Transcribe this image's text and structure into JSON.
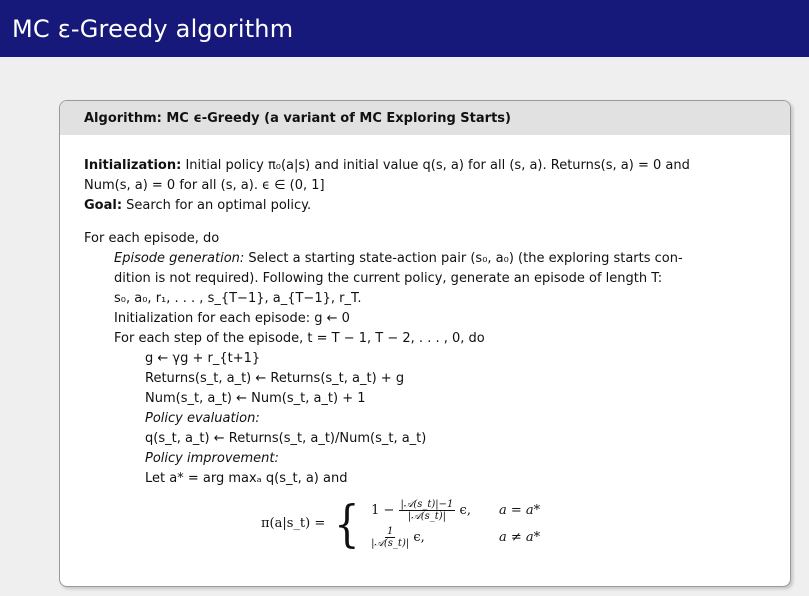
{
  "title": "MC ε-Greedy algorithm",
  "algorithm": {
    "header": "Algorithm: MC ϵ-Greedy (a variant of MC Exploring Starts)",
    "initialization_label": "Initialization:",
    "initialization_line1": "Initial policy π₀(a|s) and initial value q(s, a) for all (s, a). Returns(s, a) = 0 and",
    "initialization_line2": "Num(s, a) = 0 for all (s, a). ϵ ∈ (0, 1]",
    "goal_label": "Goal:",
    "goal_text": "Search for an optimal policy.",
    "for_each_episode": "For each episode, do",
    "episode_generation_label": "Episode generation:",
    "episode_generation_line1": "Select a starting state-action pair (s₀, a₀) (the exploring starts con-",
    "episode_generation_line2": "dition is not required). Following the current policy, generate an episode of length T:",
    "episode_generation_line3": "s₀, a₀, r₁, . . . , s_{T−1}, a_{T−1}, r_T.",
    "init_each_episode": "Initialization for each episode: g ← 0",
    "for_each_step": "For each step of the episode, t = T − 1, T − 2, . . . , 0, do",
    "step_g": "g ← γg + r_{t+1}",
    "step_returns": "Returns(s_t, a_t) ← Returns(s_t, a_t) + g",
    "step_num": "Num(s_t, a_t) ← Num(s_t, a_t) + 1",
    "policy_evaluation_label": "Policy evaluation:",
    "policy_evaluation_eq": "q(s_t, a_t) ← Returns(s_t, a_t)/Num(s_t, a_t)",
    "policy_improvement_label": "Policy improvement:",
    "let_line": "Let a* = arg maxₐ q(s_t, a) and",
    "formula": {
      "lhs": "π(a|s_t) =",
      "case1_prefix": "1 −",
      "case1_num": "|𝒜(s_t)|−1",
      "case1_den": "|𝒜(s_t)|",
      "case1_suffix": "ϵ,",
      "case1_cond": "a = a*",
      "case2_num": "1",
      "case2_den": "|𝒜(s_t)|",
      "case2_suffix": "ϵ,",
      "case2_cond": "a ≠ a*"
    }
  }
}
